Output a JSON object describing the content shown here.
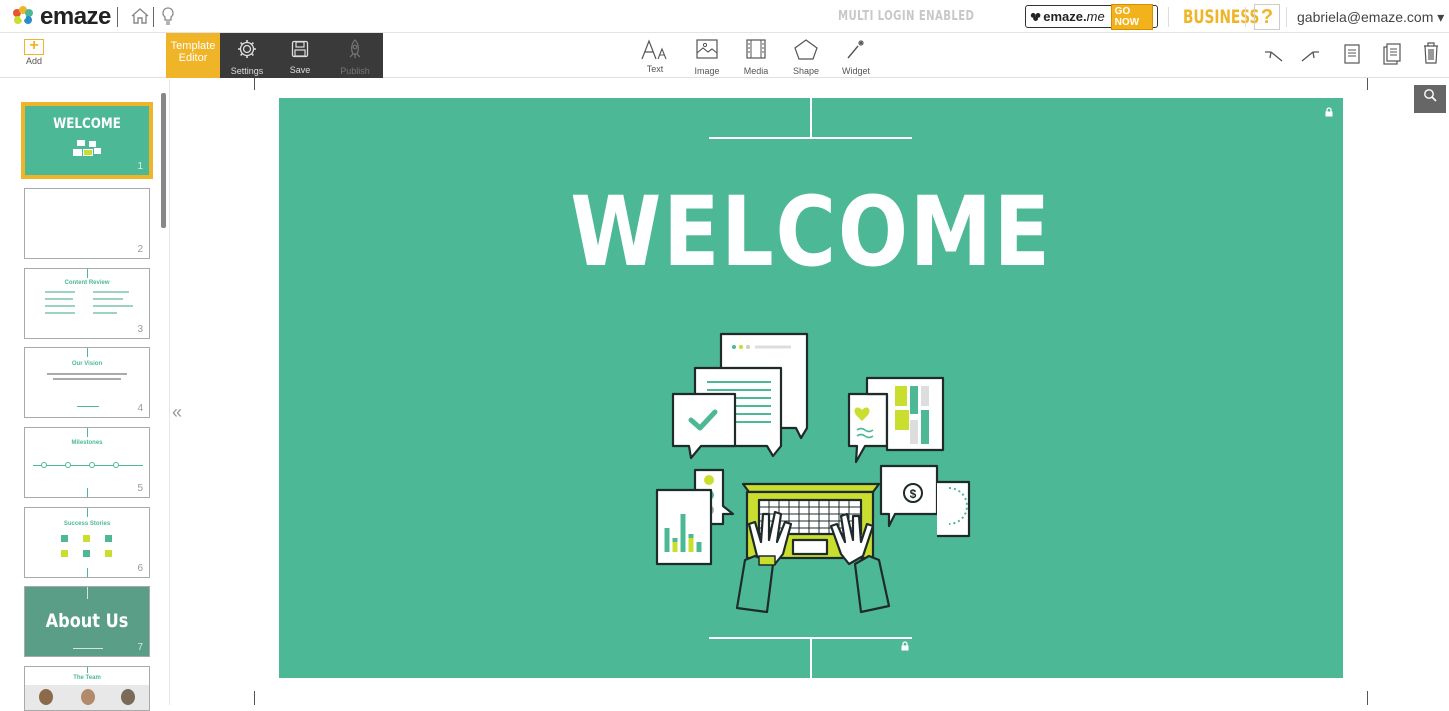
{
  "app": {
    "logo_text": "emaze",
    "multi_login": "MULTI LOGIN ENABLED",
    "emaze_me": {
      "brand": "emaze.",
      "suffix": "me",
      "cta": "GO NOW"
    },
    "plan": "BUSINESS",
    "help": "?",
    "user": "gabriela@emaze.com ▾"
  },
  "toolbar": {
    "add_label": "Add",
    "template_editor": "Template\nEditor",
    "template_line1": "Template",
    "template_line2": "Editor",
    "settings_label": "Settings",
    "save_label": "Save",
    "publish_label": "Publish",
    "text_label": "Text",
    "image_label": "Image",
    "media_label": "Media",
    "shape_label": "Shape",
    "widget_label": "Widget"
  },
  "slides": [
    {
      "num": "1",
      "title": "WELCOME",
      "selected": true
    },
    {
      "num": "2",
      "title": ""
    },
    {
      "num": "3",
      "title": "Content Review"
    },
    {
      "num": "4",
      "title": "Our Vision"
    },
    {
      "num": "5",
      "title": "Milestones"
    },
    {
      "num": "6",
      "title": "Success Stories"
    },
    {
      "num": "7",
      "title": "About Us"
    },
    {
      "num": "",
      "title": "The Team"
    }
  ],
  "slide": {
    "heading": "WELCOME",
    "bg_color": "#4db896"
  },
  "colors": {
    "accent": "#f0b429",
    "slide_green": "#4db896",
    "lime": "#c9de2f"
  }
}
